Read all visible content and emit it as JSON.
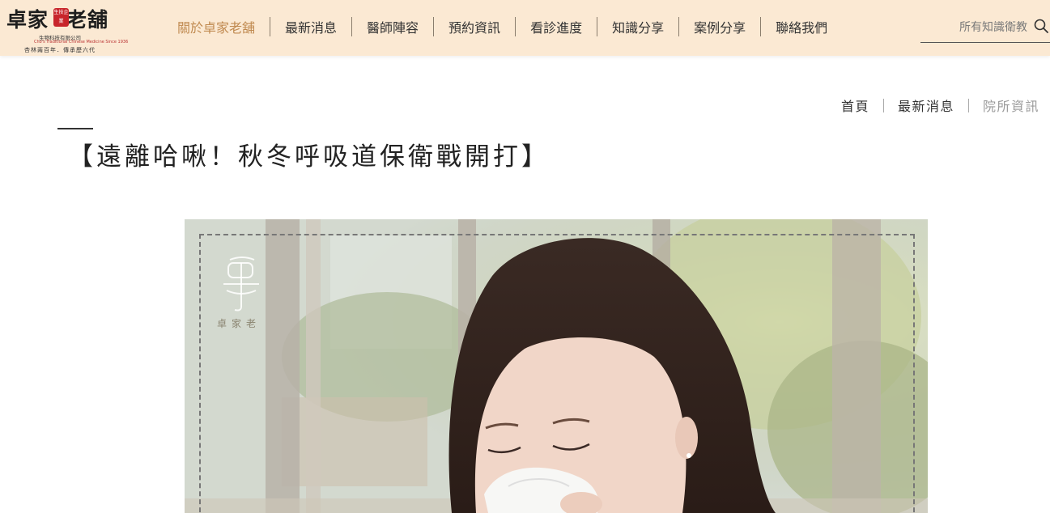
{
  "brand": {
    "name_left": "卓家",
    "name_right": "老舖",
    "seal_text": "生技企業",
    "company": "生物科技有限公司",
    "english": "Cho's Traditional Chinese Medicine Since 1936",
    "slogan": "杏林兩百年．傳承歷六代"
  },
  "nav": {
    "items": [
      {
        "label": "關於卓家老舖",
        "active": true
      },
      {
        "label": "最新消息",
        "active": false
      },
      {
        "label": "醫師陣容",
        "active": false
      },
      {
        "label": "預約資訊",
        "active": false
      },
      {
        "label": "看診進度",
        "active": false
      },
      {
        "label": "知識分享",
        "active": false
      },
      {
        "label": "案例分享",
        "active": false
      },
      {
        "label": "聯絡我們",
        "active": false
      }
    ]
  },
  "search": {
    "placeholder": "所有知識衛教"
  },
  "breadcrumb": [
    {
      "label": "首頁"
    },
    {
      "label": "最新消息"
    },
    {
      "label": "院所資訊"
    }
  ],
  "article": {
    "title": "【遠離哈啾！秋冬呼吸道保衛戰開打】"
  },
  "hero": {
    "watermark_text": "卓家老"
  },
  "colors": {
    "header_bg": "#fbe9d3",
    "nav_active": "#c08a50",
    "seal_red": "#c8252b"
  }
}
